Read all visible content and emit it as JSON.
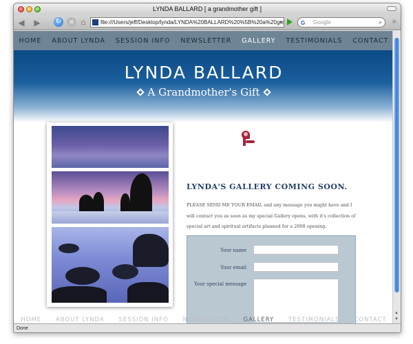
{
  "window": {
    "title": "LYNDA BALLARD [ a grandmother gift ]"
  },
  "toolbar": {
    "back_glyph": "◀",
    "forward_glyph": "▶",
    "reload_glyph": "↻",
    "stop_glyph": "✕",
    "home_glyph": "⌂",
    "url": "file:///Users/jeff/Desktop/lynda/LYNDA%20BALLARD%20%5B%20a%20grandmo",
    "search_engine": "G",
    "search_placeholder": "Google"
  },
  "nav": {
    "items": [
      {
        "label": "HOME"
      },
      {
        "label": "ABOUT LYNDA"
      },
      {
        "label": "SESSION INFO"
      },
      {
        "label": "NEWSLETTER"
      },
      {
        "label": "GALLERY",
        "active": true
      },
      {
        "label": "TESTIMONIALS"
      },
      {
        "label": "CONTACT"
      }
    ]
  },
  "banner": {
    "title": "LYNDA BALLARD",
    "tagline": "A Grandmother's Gift"
  },
  "gallery": {
    "heading": "LYNDA'S GALLERY COMING SOON.",
    "body": "PLEASE SEND ME YOUR EMAIL and any message you might have and I will contact you as soon as my special Gallery opens, with it's collection of special art and spiritual artifacts planned for a 2008 opening."
  },
  "form": {
    "name_label": "Your name",
    "email_label": "Your email",
    "message_label": "Your special message",
    "name_value": "",
    "email_value": "",
    "message_value": ""
  },
  "statusbar": {
    "text": "Done"
  },
  "colors": {
    "nav_bg": "#6e8596",
    "banner_top": "#0b4a85",
    "form_bg": "#bac8d2",
    "heading": "#223e6b",
    "logo": "#a8233a"
  },
  "icons": [
    "back-icon",
    "forward-icon",
    "reload-icon",
    "stop-icon",
    "home-icon",
    "search-icon",
    "diamond-icon",
    "logo-mark-icon"
  ]
}
